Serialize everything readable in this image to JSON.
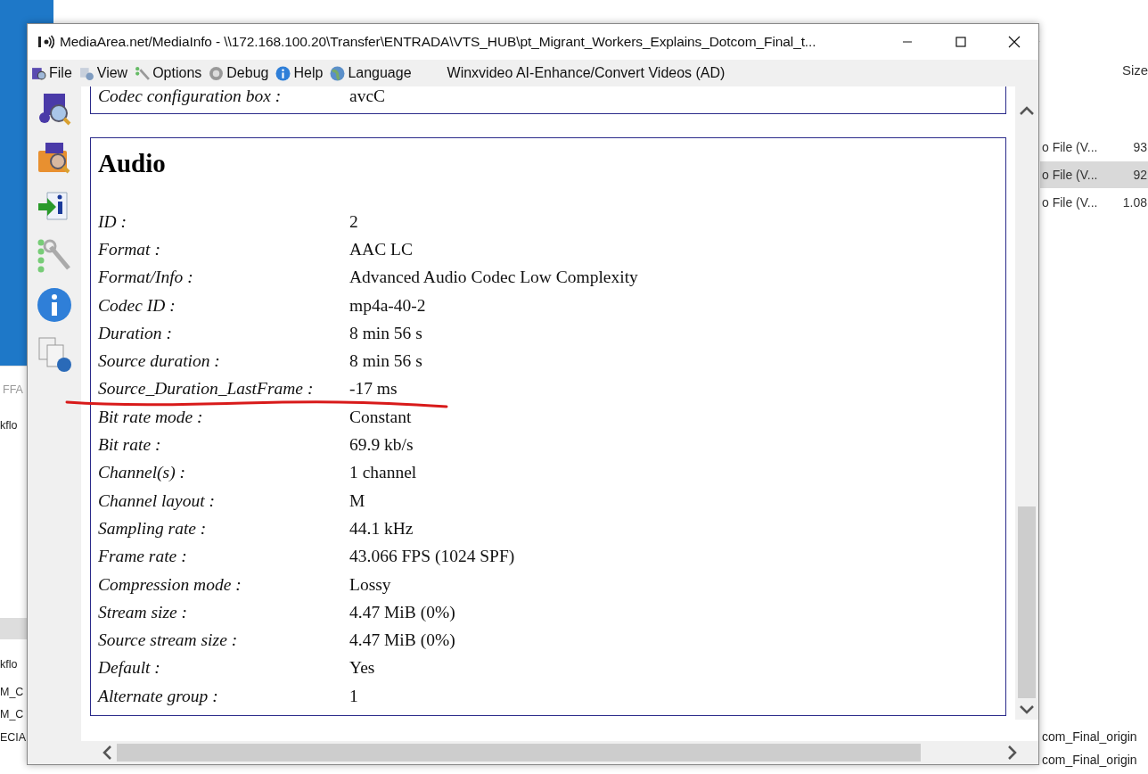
{
  "background_window": {
    "left_column": [
      "FFA",
      "kflo",
      "kflo",
      "M_C",
      "M_C",
      "ECIA"
    ],
    "size_header": "Size",
    "rows": [
      {
        "type": "o File (V...",
        "size": "93",
        "selected": false
      },
      {
        "type": "o File (V...",
        "size": "92",
        "selected": true
      },
      {
        "type": "o File (V...",
        "size": "1.08",
        "selected": false
      }
    ],
    "path_fragments": [
      "com_Final_origin",
      "com_Final_origin"
    ]
  },
  "window": {
    "title": "MediaArea.net/MediaInfo - \\\\172.168.100.20\\Transfer\\ENTRADA\\VTS_HUB\\pt_Migrant_Workers_Explains_Dotcom_Final_t..."
  },
  "menu": [
    {
      "label": "File",
      "kind": "file"
    },
    {
      "label": "View",
      "kind": "view"
    },
    {
      "label": "Options",
      "kind": "options"
    },
    {
      "label": "Debug",
      "kind": "debug"
    },
    {
      "label": "Help",
      "kind": "help"
    },
    {
      "label": "Language",
      "kind": "language"
    }
  ],
  "ad_link": "Winxvideo AI-Enhance/Convert Videos (AD)",
  "previous_section": {
    "rows": [
      {
        "label": "Codec configuration box :",
        "value": "avcC"
      }
    ]
  },
  "section": {
    "title": "Audio",
    "rows": [
      {
        "label": "ID :",
        "value": "2"
      },
      {
        "label": "Format :",
        "value": "AAC LC"
      },
      {
        "label": "Format/Info :",
        "value": "Advanced Audio Codec Low Complexity"
      },
      {
        "label": "Codec ID :",
        "value": "mp4a-40-2"
      },
      {
        "label": "Duration :",
        "value": "8 min 56 s"
      },
      {
        "label": "Source duration :",
        "value": "8 min 56 s"
      },
      {
        "label": "Source_Duration_LastFrame :",
        "value": "-17 ms"
      },
      {
        "label": "Bit rate mode :",
        "value": "Constant"
      },
      {
        "label": "Bit rate :",
        "value": "69.9 kb/s"
      },
      {
        "label": "Channel(s) :",
        "value": "1 channel"
      },
      {
        "label": "Channel layout :",
        "value": "M"
      },
      {
        "label": "Sampling rate :",
        "value": "44.1 kHz"
      },
      {
        "label": "Frame rate :",
        "value": "43.066 FPS (1024 SPF)"
      },
      {
        "label": "Compression mode :",
        "value": "Lossy"
      },
      {
        "label": "Stream size :",
        "value": "4.47 MiB (0%)"
      },
      {
        "label": "Source stream size :",
        "value": "4.47 MiB (0%)"
      },
      {
        "label": "Default :",
        "value": "Yes"
      },
      {
        "label": "Alternate group :",
        "value": "1"
      }
    ]
  }
}
